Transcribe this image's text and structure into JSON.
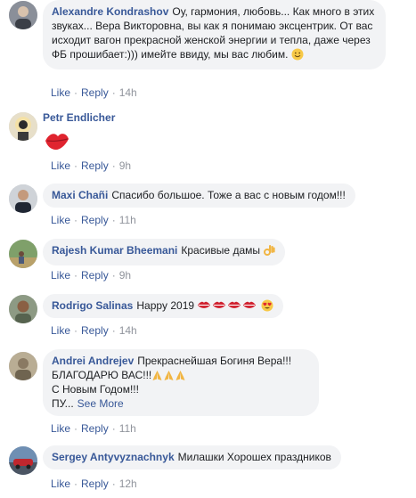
{
  "comments": [
    {
      "name": "Alexandre Kondrashov",
      "text": "Оу, гармония, любовь... Как много в этих звуках... Вера Викторовна, вы как я понимаю эксцентрик. От вас исходит вагон прекрасной женской энергии и тепла, даже через ФБ прошибает:))) имейте ввиду, мы вас любим.",
      "emoji": "smiling-face-icon",
      "like": "Like",
      "reply": "Reply",
      "time": "14h"
    },
    {
      "name": "Petr Endlicher",
      "text": "",
      "emoji": "kiss-mark-icon",
      "like": "Like",
      "reply": "Reply",
      "time": "9h"
    },
    {
      "name": "Maxi Chañi",
      "text": "Спасибо большое. Тоже а вас с новым годом!!!",
      "like": "Like",
      "reply": "Reply",
      "time": "11h"
    },
    {
      "name": "Rajesh Kumar Bheemani",
      "text": "Красивые дамы",
      "emoji": "ok-hand-icon",
      "like": "Like",
      "reply": "Reply",
      "time": "9h"
    },
    {
      "name": "Rodrigo Salinas",
      "text": "Happy 2019",
      "emoji": "lips-and-heart-eyes-icons",
      "like": "Like",
      "reply": "Reply",
      "time": "14h"
    },
    {
      "name": "Andrei Andrejev",
      "text": "Прекраснейшая Богиня Вера!!!\nБЛАГОДАРЮ ВАС!!!",
      "text2": "С Новым Годом!!!",
      "text3": "ПУ...",
      "see_more": "See More",
      "emoji": "folded-hands-icon",
      "like": "Like",
      "reply": "Reply",
      "time": "11h"
    },
    {
      "name": "Sergey Antyvyznachnyk",
      "text": "Милашки Хорошех праздников",
      "like": "Like",
      "reply": "Reply",
      "time": "12h"
    }
  ],
  "colors": {
    "link": "#385898",
    "bubble": "#f2f3f5",
    "meta": "#90949c"
  }
}
